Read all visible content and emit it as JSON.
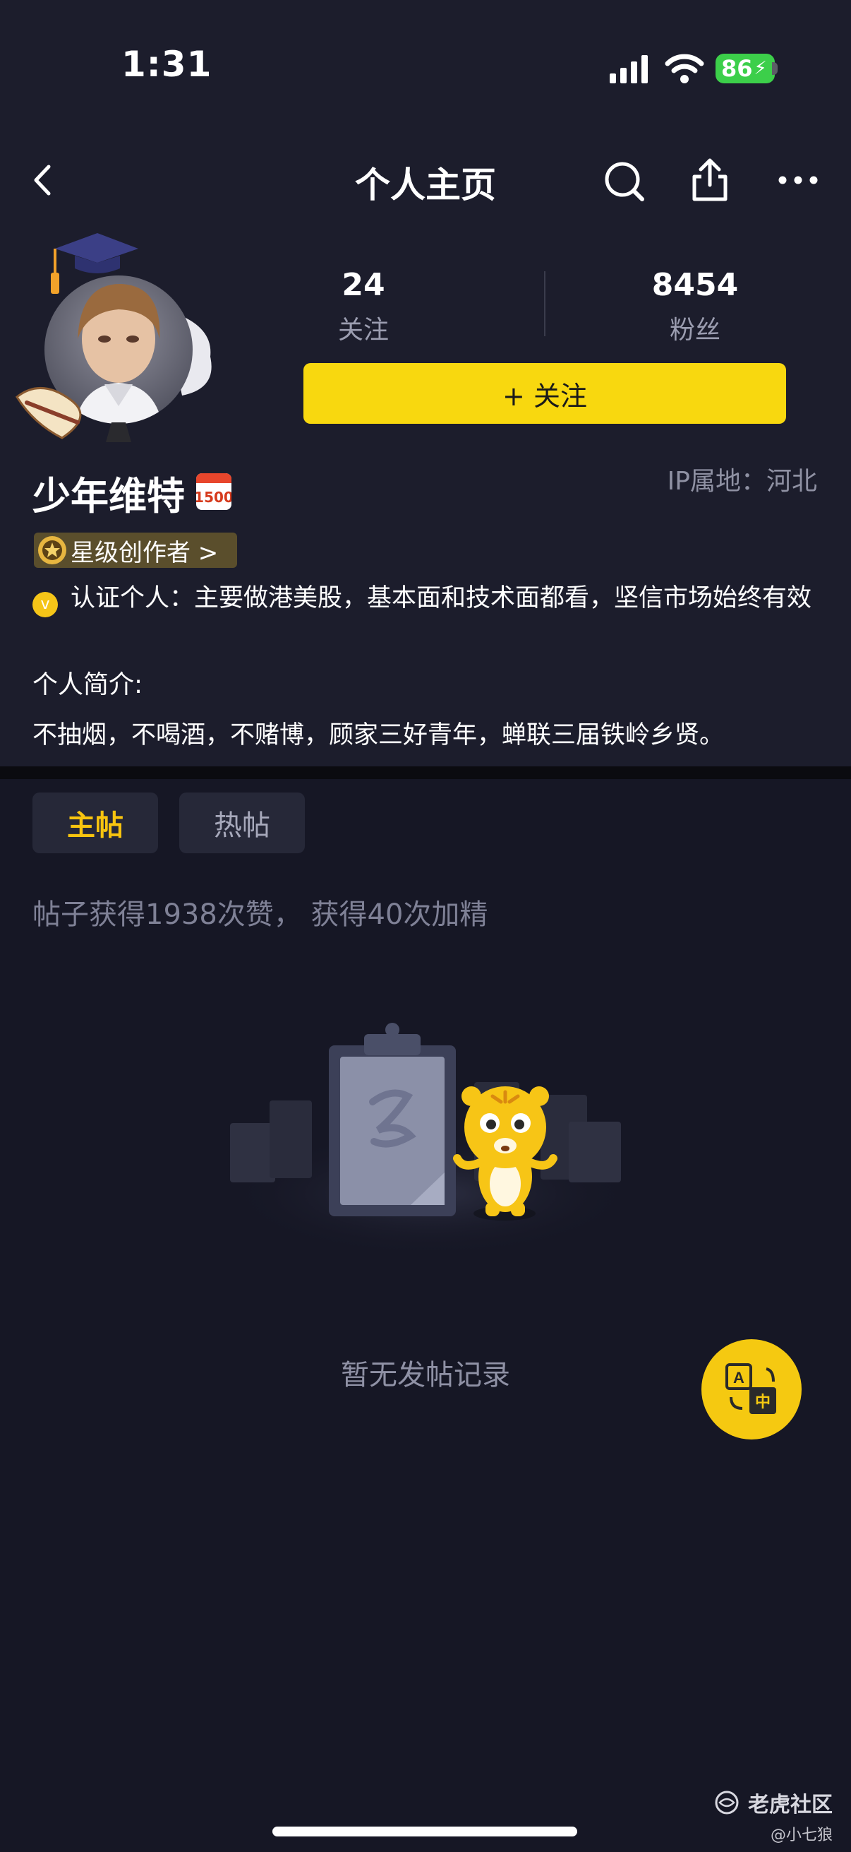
{
  "status_bar": {
    "time": "1:31",
    "battery": "86"
  },
  "nav": {
    "back_icon": "chevron-left-icon",
    "title": "个人主页",
    "search_icon": "search-icon",
    "share_icon": "share-icon",
    "more_icon": "more-dots-icon"
  },
  "profile": {
    "following_count": "24",
    "following_label": "关注",
    "followers_count": "8454",
    "followers_label": "粉丝",
    "follow_button": "+ 关注",
    "username": "少年维特",
    "calendar_badge": "1500",
    "ip_location": "IP属地：河北",
    "star_badge": "星级创作者 >",
    "verify_icon_text": "v",
    "verification": "认证个人：主要做港美股，基本面和技术面都看，坚信市场始终有效",
    "bio_label": "个人简介:",
    "bio": "不抽烟，不喝酒，不赌博，顾家三好青年，蝉联三届铁岭乡贤。"
  },
  "tabs": [
    {
      "label": "主帖",
      "active": true
    },
    {
      "label": "热帖",
      "active": false
    }
  ],
  "summary": "帖子获得1938次赞， 获得40次加精",
  "empty_state": {
    "text": "暂无发帖记录"
  },
  "translate_button": {
    "icon": "translate-icon",
    "glyph_a": "A",
    "glyph_zh": "中"
  },
  "watermark": {
    "brand": "老虎社区",
    "sub": "@小七狼"
  },
  "colors": {
    "accent": "#f8d80f",
    "background": "#161725",
    "header_bg": "#1c1d2c"
  }
}
